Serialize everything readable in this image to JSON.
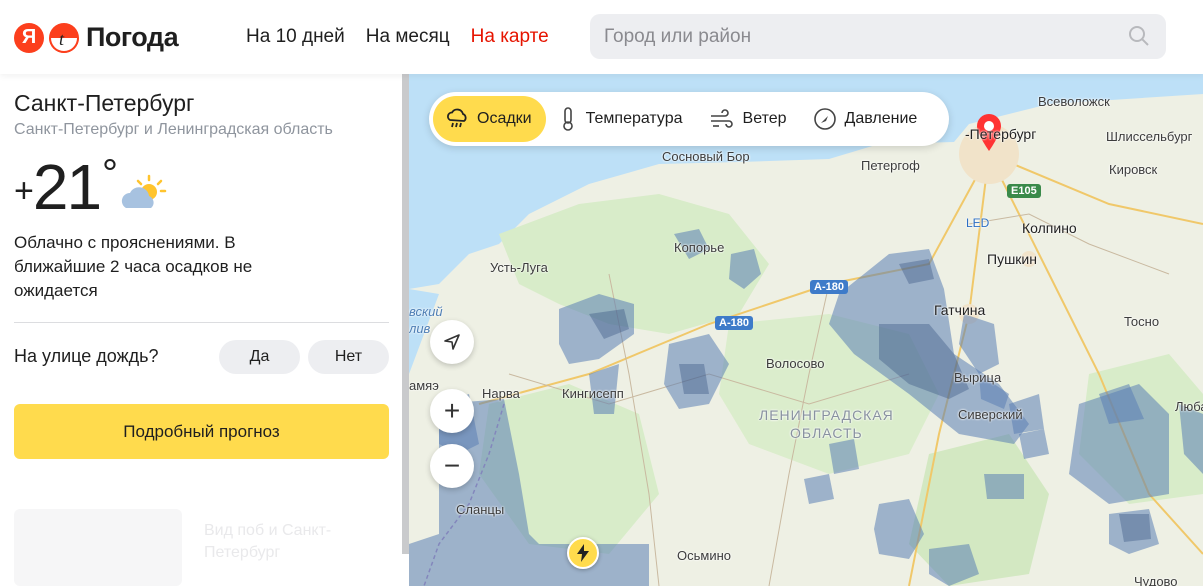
{
  "header": {
    "logo_letter": "Я",
    "logo_title": "Погода",
    "nav": [
      {
        "label": "На 10 дней",
        "active": false
      },
      {
        "label": "На месяц",
        "active": false
      },
      {
        "label": "На карте",
        "active": true
      }
    ],
    "search_placeholder": "Город или район"
  },
  "location": {
    "city": "Санкт-Петербург",
    "region": "Санкт-Петербург и Ленинградская область"
  },
  "current": {
    "sign": "+",
    "temperature": "21",
    "degree": "°",
    "icon": "partly-cloudy-icon",
    "description": "Облачно с прояснениями. В ближайшие 2 часа осадков не ожидается"
  },
  "rain_question": {
    "label": "На улице дождь?",
    "yes": "Да",
    "no": "Нет"
  },
  "forecast_button": "Подробный прогноз",
  "ghost_card": {
    "text": "Вид поб и Санкт-Петербург"
  },
  "map": {
    "layers": [
      {
        "label": "Осадки",
        "icon": "precipitation-icon",
        "active": true
      },
      {
        "label": "Температура",
        "icon": "thermometer-icon",
        "active": false
      },
      {
        "label": "Ветер",
        "icon": "wind-icon",
        "active": false
      },
      {
        "label": "Давление",
        "icon": "pressure-icon",
        "active": false
      }
    ],
    "controls": {
      "locate": "navigation-arrow-icon",
      "zoom_in": "+",
      "zoom_out": "−"
    },
    "places": {
      "spb": "Санкт-Петербург",
      "spb_visible": "-Петербург",
      "vsevolozhsk": "Всеволожск",
      "shlisselburg": "Шлиссельбург",
      "kirovsk": "Кировск",
      "sosnovy_bor": "Сосновый Бор",
      "peterhof": "Петергоф",
      "kolpino": "Колпино",
      "pushkin": "Пушкин",
      "koporye": "Копорье",
      "ust_luga": "Усть-Луга",
      "gatchina": "Гатчина",
      "volosovo": "Волосово",
      "vyritsa": "Вырица",
      "siversky": "Сиверский",
      "tosno": "Тосно",
      "narva": "Нарва",
      "kingisepp": "Кингисепп",
      "slantsy": "Сланцы",
      "osmino": "Осьмино",
      "lyuban": "Люба",
      "led": "LED",
      "region_line1": "ЛЕНИНГРАДСКАЯ",
      "region_line2": "ОБЛАСТЬ",
      "estonia_fragment_1": "вский",
      "estonia_fragment_2": "лив",
      "estonia_fragment_3": "амяэ",
      "chudovo_fragment": "Чудово"
    },
    "roads": [
      "E105",
      "А-180",
      "А-180"
    ]
  }
}
